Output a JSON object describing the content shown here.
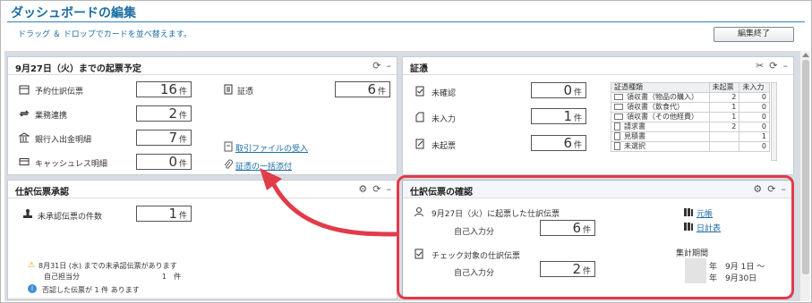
{
  "header": {
    "title": "ダッシュボードの編集",
    "subtitle": "ドラッグ ＆ ドロップでカードを並べ替えます。",
    "end_button": "編集終了"
  },
  "schedule_card": {
    "title": "9月27日（火）までの起票予定",
    "rows": [
      {
        "label": "予約仕訳伝票",
        "value": "16",
        "unit": "件",
        "icon": "calendar-icon"
      },
      {
        "label": "業務連携",
        "value": "2",
        "unit": "件",
        "icon": "sync-icon"
      },
      {
        "label": "銀行入出金明細",
        "value": "7",
        "unit": "件",
        "icon": "bank-icon"
      },
      {
        "label": "キャッシュレス明細",
        "value": "0",
        "unit": "件",
        "icon": "card-icon"
      }
    ],
    "voucher": {
      "label": "証憑",
      "value": "6",
      "unit": "件",
      "icon": "document-icon"
    },
    "links": [
      "取引ファイルの受入",
      "証憑の一括添付"
    ]
  },
  "evidence_card": {
    "title": "証憑",
    "rows": [
      {
        "label": "未確認",
        "value": "0",
        "unit": "件"
      },
      {
        "label": "未入力",
        "value": "1",
        "unit": "件"
      },
      {
        "label": "未起票",
        "value": "6",
        "unit": "件"
      }
    ],
    "table": {
      "headers": [
        "証憑種類",
        "未起票",
        "未入力"
      ],
      "rows": [
        [
          "領収書（物品の購入）",
          "2",
          "0"
        ],
        [
          "領収書（飲食代）",
          "1",
          "0"
        ],
        [
          "領収書（その他経費）",
          "1",
          "0"
        ],
        [
          "請求書",
          "2",
          "0"
        ],
        [
          "見積書",
          "",
          "1"
        ],
        [
          "未選択",
          "",
          "0"
        ]
      ]
    }
  },
  "approval_card": {
    "title": "仕訳伝票承認",
    "row": {
      "label": "未承認伝票の件数",
      "value": "1",
      "unit": "件"
    },
    "warning": "8月31日 (水) までの未承認伝票があります",
    "own_label": "自己担当分",
    "own_value": "1　件",
    "info": "否認した伝票が 1 件 あります"
  },
  "confirm_card": {
    "title": "仕訳伝票の確認",
    "section1": {
      "label": "9月27日（火）に起票した仕訳伝票",
      "sub": "自己入力分",
      "value": "6",
      "unit": "件"
    },
    "section2": {
      "label": "チェック対象の仕訳伝票",
      "sub": "自己入力分",
      "value": "2",
      "unit": "件"
    },
    "links": [
      "元帳",
      "日計表"
    ],
    "period": {
      "label": "集計期間",
      "from": "年　9月 1日 ～",
      "to": "年　9月30日"
    }
  },
  "colors": {
    "accent": "#1c6ea4",
    "highlight": "#e23b4a"
  }
}
